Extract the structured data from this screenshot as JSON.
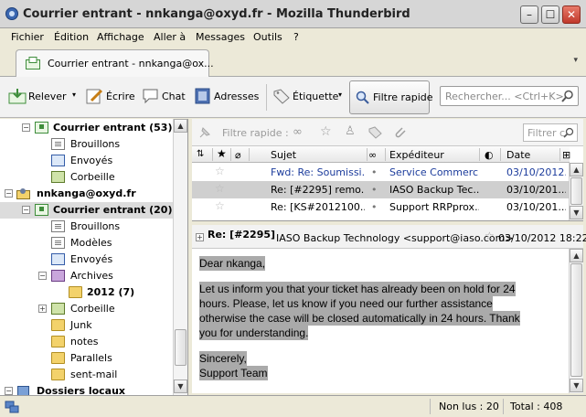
{
  "window": {
    "title": "Courrier entrant - nnkanga@oxyd.fr - Mozilla Thunderbird",
    "buttons": {
      "minimize": "–",
      "maximize": "☐",
      "close": "✕"
    }
  },
  "menu": [
    "Fichier",
    "Édition",
    "Affichage",
    "Aller à",
    "Messages",
    "Outils",
    "?"
  ],
  "tabs": [
    {
      "label": "Courrier entrant - nnkanga@ox..."
    }
  ],
  "toolbar": {
    "get_mail": "Relever",
    "write": "Écrire",
    "chat": "Chat",
    "address_book": "Adresses",
    "tag": "Étiquette",
    "quick_filter": "Filtre rapide",
    "search_placeholder": "Rechercher... <Ctrl+K>"
  },
  "folders": [
    {
      "label": "Courrier entrant (53)",
      "bold": true
    },
    {
      "label": "Brouillons"
    },
    {
      "label": "Envoyés"
    },
    {
      "label": "Corbeille"
    },
    {
      "label": "nnkanga@oxyd.fr",
      "bold": true
    },
    {
      "label": "Courrier entrant (20)",
      "bold": true
    },
    {
      "label": "Brouillons"
    },
    {
      "label": "Modèles"
    },
    {
      "label": "Envoyés"
    },
    {
      "label": "Archives"
    },
    {
      "label": "2012 (7)",
      "bold": true
    },
    {
      "label": "Corbeille"
    },
    {
      "label": "Junk"
    },
    {
      "label": "notes"
    },
    {
      "label": "Parallels"
    },
    {
      "label": "sent-mail"
    },
    {
      "label": "Dossiers locaux",
      "bold": true
    }
  ],
  "quick_filter": {
    "label": "Filtre rapide :",
    "input_placeholder": "Filtrer c"
  },
  "thread": {
    "columns": {
      "subject": "Sujet",
      "sender": "Expéditeur",
      "date": "Date"
    },
    "rows": [
      {
        "subject": "Fwd: Re: Soumissi...",
        "sender": "Service Commerci...",
        "date": "03/10/2012...",
        "dot": "•",
        "unread": true
      },
      {
        "subject": "Re: [#2295] remo...",
        "sender": "IASO Backup Tec...",
        "date": "03/10/201...",
        "dot": "•",
        "unread": false,
        "selected": true
      },
      {
        "subject": "Re: [KS#2012100...",
        "sender": "Support RRPprox...",
        "date": "03/10/201...",
        "dot": "•",
        "unread": false
      }
    ]
  },
  "message": {
    "subject": "Re: [#2295]",
    "from": "IASO Backup Technology <support@iaso.com>",
    "date": "03/10/2012 18:22",
    "body": [
      "Dear nkanga,",
      "",
      "Let us inform you that your ticket has already been on hold for 24",
      "hours. Please, let us know if you need our further assistance",
      "otherwise the case will be closed automatically in 24 hours. Thank",
      "you for understanding.",
      "",
      "Sincerely,",
      "Support Team"
    ]
  },
  "status": {
    "unread": "Non lus : 20",
    "total": "Total : 408"
  }
}
